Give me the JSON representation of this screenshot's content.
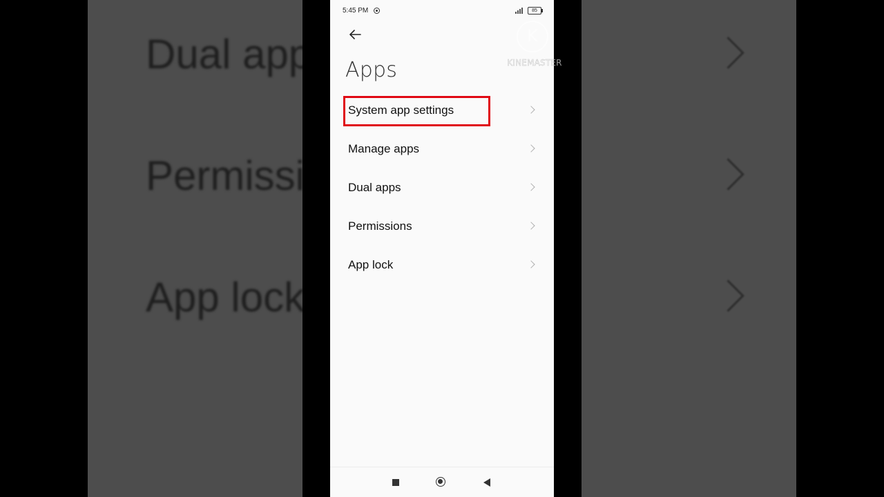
{
  "status_bar": {
    "time": "5:45 PM",
    "battery": "85"
  },
  "header": {
    "back_icon": "arrow-left-icon",
    "title": "Apps"
  },
  "menu": {
    "items": [
      {
        "label": "System app settings",
        "highlighted": true
      },
      {
        "label": "Manage apps",
        "highlighted": false
      },
      {
        "label": "Dual apps",
        "highlighted": false
      },
      {
        "label": "Permissions",
        "highlighted": false
      },
      {
        "label": "App lock",
        "highlighted": false
      }
    ]
  },
  "highlight_color": "#e00914",
  "background_zoom": {
    "items": [
      "Dual apps",
      "Permissions",
      "App lock"
    ]
  },
  "watermark": {
    "logo_letter": "K",
    "text": "KINEMASTER"
  },
  "nav_bar": {
    "recents_icon": "square-icon",
    "home_icon": "circle-icon",
    "back_icon": "triangle-back-icon"
  }
}
